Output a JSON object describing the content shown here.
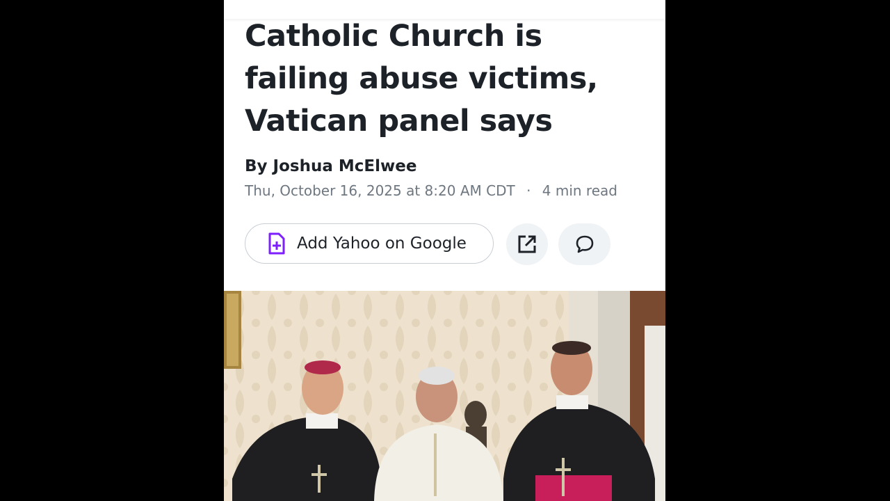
{
  "article": {
    "headline": "Catholic Church is failing abuse victims, Vatican panel says",
    "byline": "By Joshua McElwee",
    "date": "Thu, October 16, 2025 at 8:20 AM CDT",
    "separator": "·",
    "read_time": "4 min read"
  },
  "actions": {
    "add_label": "Add Yahoo on Google",
    "add_icon": "document-plus-icon",
    "share_icon": "external-share-icon",
    "comment_icon": "comment-bubble-icon",
    "accent_color": "#7e1fff"
  },
  "photo": {
    "icon": "article-photo"
  }
}
